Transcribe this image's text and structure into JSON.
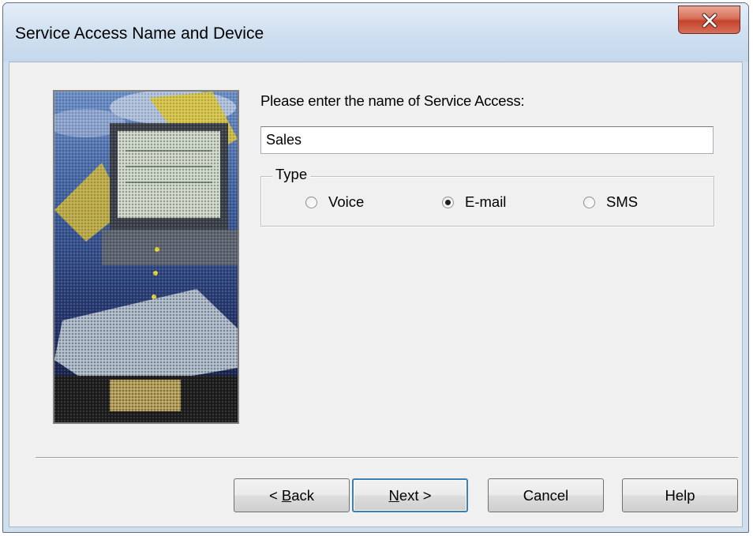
{
  "window": {
    "title": "Service Access Name and Device"
  },
  "form": {
    "prompt": "Please enter the name of Service Access:",
    "name_value": "Sales",
    "type_legend": "Type",
    "type_options": [
      {
        "label": "Voice",
        "checked": false
      },
      {
        "label": "E-mail",
        "checked": true
      },
      {
        "label": "SMS",
        "checked": false
      }
    ]
  },
  "buttons": {
    "back_mnemonic": "B",
    "back_rest": "ack",
    "back_prefix": "< ",
    "next_mnemonic": "N",
    "next_rest": "ext >",
    "cancel": "Cancel",
    "help": "Help"
  },
  "colors": {
    "close_button": "#c5432b",
    "default_button_border": "#3c7fb1"
  }
}
